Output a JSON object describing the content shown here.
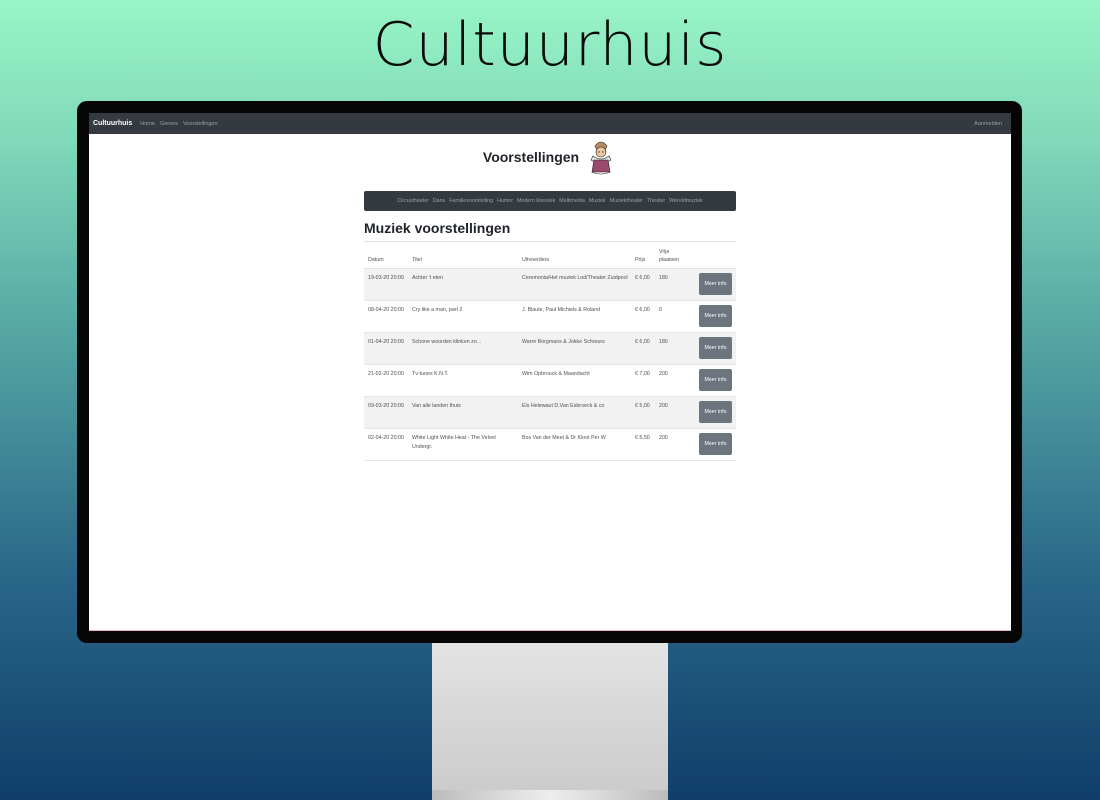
{
  "hero": {
    "title": "Cultuurhuis"
  },
  "nav": {
    "brand": "Cultuurhuis",
    "links": [
      "Home",
      "Genres",
      "Voorstellingen"
    ],
    "right_link": "Aanmelden"
  },
  "page": {
    "heading": "Voorstellingen"
  },
  "genres": [
    "Circustheater",
    "Dans",
    "Familievoorstelling",
    "Humor",
    "Modern klassiek",
    "Multimedia",
    "Muziek",
    "Muziektheater",
    "Theater",
    "Wereldmuziek"
  ],
  "section": {
    "title": "Muziek voorstellingen"
  },
  "table": {
    "headers": {
      "datum": "Datum",
      "titel": "Titel",
      "uitvoerders": "Uitvoerders",
      "prijs": "Prijs",
      "vrije_plaatsen": "Vrije plaatsen"
    },
    "button_label": "Meer info",
    "rows": [
      {
        "datum": "19-03-20 20:00",
        "titel": "Achter 't eten",
        "uitvoerders": "Ceremonia/Het muziek Lod/Theater Zuidpool",
        "prijs": "€ 6,00",
        "vrij": "180"
      },
      {
        "datum": "08-04-20 20:00",
        "titel": "Cry like a man, part 2",
        "uitvoerders": "J. Blaute, Paul Michiels & Roland",
        "prijs": "€ 6,00",
        "vrij": "0"
      },
      {
        "datum": "01-04-20 20:00",
        "titel": "Schone woorden klinken zo...",
        "uitvoerders": "Warre Borgmans & Jokke Schreurs",
        "prijs": "€ 6,00",
        "vrij": "180"
      },
      {
        "datum": "21-02-20 20:00",
        "titel": "Tv-tunes K.N.T.",
        "uitvoerders": "Wim Opbrouck & Maandacht",
        "prijs": "€ 7,00",
        "vrij": "200"
      },
      {
        "datum": "09-03-20 20:00",
        "titel": "Van alle landen thuis",
        "uitvoerders": "Els Helewaut D.Van Esbroeck & co",
        "prijs": "€ 5,00",
        "vrij": "200"
      },
      {
        "datum": "02-04-20 20:00",
        "titel": "White Light White Heat - The Velvet Undergr.",
        "uitvoerders": "Bos Van der Meet & Dr Kloot Per W",
        "prijs": "€ 5,50",
        "vrij": "200"
      }
    ]
  },
  "colors": {
    "navbar": "#343a40",
    "button": "#6c757d",
    "bg_top": "#98f5c6",
    "bg_bottom": "#0f3e6a"
  },
  "icons": {
    "mascot": "jester-mascot-icon"
  }
}
